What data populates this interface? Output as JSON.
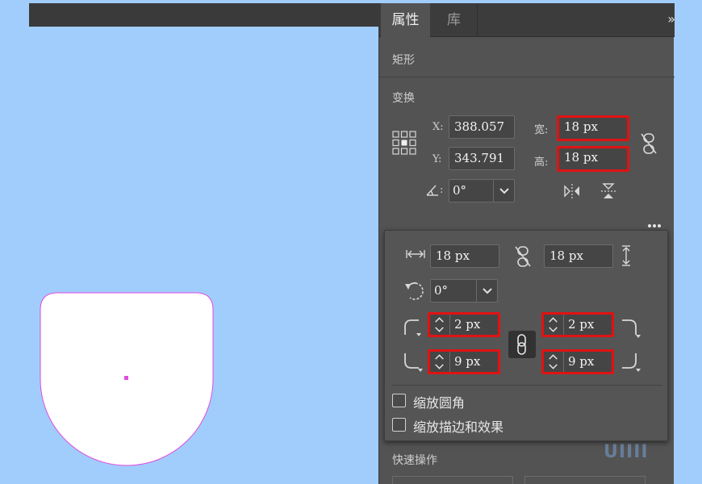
{
  "panel": {
    "tabs": [
      {
        "label": "属性"
      },
      {
        "label": "库"
      }
    ],
    "collapse": "»",
    "object_type": "矩形",
    "transform": {
      "title": "变换",
      "x_label": "X:",
      "x_value": "388.057",
      "y_label": "Y:",
      "y_value": "343.791",
      "w_label": "宽:",
      "w_value": "18 px",
      "h_label": "高:",
      "h_value": "18 px",
      "angle_label": ":",
      "angle_value": "0°"
    },
    "quick_actions": "快速操作"
  },
  "popup": {
    "width_value": "18 px",
    "height_value": "18 px",
    "rotation_value": "0°",
    "corners": {
      "top_left": "2 px",
      "top_right": "2 px",
      "bottom_left": "9 px",
      "bottom_right": "9 px"
    },
    "scale_corners_label": "缩放圆角",
    "scale_strokes_label": "缩放描边和效果"
  },
  "watermark": "UIIII",
  "colors": {
    "highlight": "#e01212",
    "canvas": "#a1cdfc",
    "panel": "#535353",
    "selection": "#e04ce0"
  }
}
